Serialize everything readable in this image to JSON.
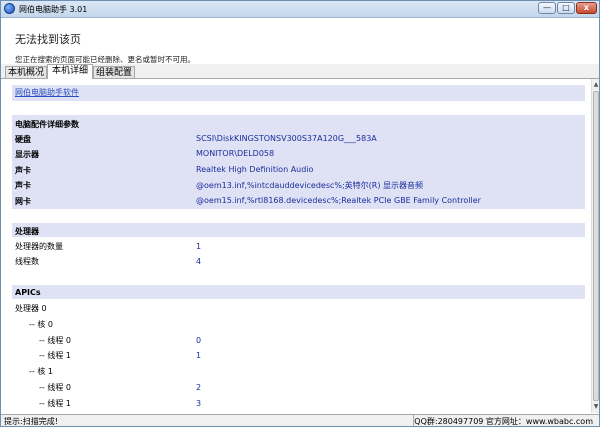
{
  "window": {
    "title": "网伯电脑助手 3.01",
    "min": "—",
    "max": "□",
    "close": "x"
  },
  "error": {
    "title": "无法找到该页",
    "desc": "您正在搜索的页面可能已经删除、更名或暂时不可用。"
  },
  "tabs": [
    {
      "label": "本机概况"
    },
    {
      "label": "本机详细"
    },
    {
      "label": "组装配置"
    }
  ],
  "link": "网伯电脑助手软件",
  "hw_section": {
    "title": "电脑配件详细参数",
    "rows": [
      {
        "label": "硬盘",
        "value": "SCSI\\DiskKINGSTONSV300S37A120G___583A"
      },
      {
        "label": "显示器",
        "value": "MONITOR\\DELD058"
      },
      {
        "label": "声卡",
        "value": "Realtek High Definition Audio"
      },
      {
        "label": "声卡",
        "value": "@oem13.inf,%intcdauddevicedesc%;英特尔(R) 显示器音频"
      },
      {
        "label": "网卡",
        "value": "@oem15.inf,%rtl8168.devicedesc%;Realtek PCIe GBE Family Controller"
      }
    ]
  },
  "cpu_section": {
    "title": "处理器",
    "rows": [
      {
        "label": "处理器的数量",
        "value": "1"
      },
      {
        "label": "线程数",
        "value": "4"
      }
    ]
  },
  "apic_section": {
    "title": "APICs",
    "rows": [
      {
        "label": "处理器 0",
        "value": ""
      },
      {
        "label": "-- 核 0",
        "value": ""
      },
      {
        "label": "-- 线程 0",
        "value": "0"
      },
      {
        "label": "-- 线程 1",
        "value": "1"
      },
      {
        "label": "-- 核 1",
        "value": ""
      },
      {
        "label": "-- 线程 0",
        "value": "2"
      },
      {
        "label": "-- 线程 1",
        "value": "3"
      }
    ]
  },
  "status": {
    "left": "提示:扫描完成!",
    "right": "QQ群:280497709 官方网址：www.wbabc.com"
  }
}
